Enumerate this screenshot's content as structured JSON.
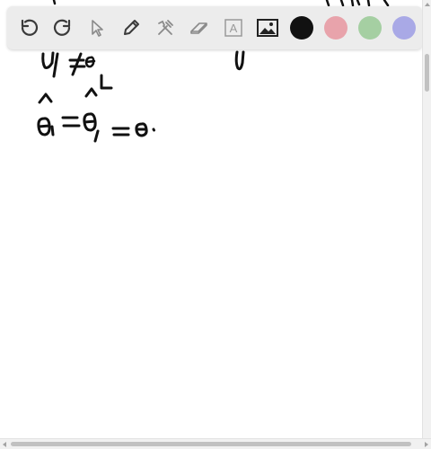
{
  "toolbar": {
    "tools": [
      {
        "name": "undo-icon"
      },
      {
        "name": "redo-icon"
      },
      {
        "name": "select-pointer-icon"
      },
      {
        "name": "pen-icon"
      },
      {
        "name": "tools-icon"
      },
      {
        "name": "eraser-icon"
      },
      {
        "name": "text-tool-icon",
        "glyph": "A"
      },
      {
        "name": "image-icon"
      }
    ],
    "colors": [
      {
        "name": "black",
        "hex": "#111111",
        "selected": true
      },
      {
        "name": "pink",
        "hex": "#e8a3ab",
        "selected": false
      },
      {
        "name": "green",
        "hex": "#a5cfa2",
        "selected": false
      },
      {
        "name": "lavender",
        "hex": "#a9a9e6",
        "selected": false
      }
    ]
  },
  "canvas": {
    "background": "#ffffff",
    "ink_color": "#111111"
  }
}
